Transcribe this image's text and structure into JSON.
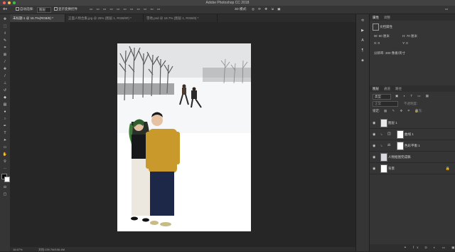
{
  "window": {
    "title": "Adobe Photoshop CC 2018",
    "traffic_lights": [
      "#fc605b",
      "#fdbc40",
      "#34c84a"
    ]
  },
  "options_bar": {
    "auto_select_label": "自动选择:",
    "auto_select_value": "图层",
    "show_transform_label": "显示变换控件",
    "mode_3d_label": "3D 模式:"
  },
  "tabs": [
    {
      "label": "未标题-1 @ 16.7%(RGB/8) *",
      "active": true
    },
    {
      "label": "正面人物合集.jpg @ 25% (图层 1, RGB/8#) *",
      "active": false
    },
    {
      "label": "雪地.psd @ 18.7% (图层 1, RGB/8) *",
      "active": false
    }
  ],
  "status": {
    "zoom": "16.67%",
    "doc_size": "文档:139.7M/106.4M"
  },
  "properties_panel": {
    "tabs": [
      "属性",
      "调整"
    ],
    "section_title": "文档属性",
    "width_label": "W: 60 厘米",
    "height_label": "H: 70 厘米",
    "x_label": "X: 0",
    "y_label": "Y: 0",
    "resolution": "分辨率: 300 像素/英寸"
  },
  "layers_panel": {
    "tabs": [
      "图层",
      "通道",
      "路径"
    ],
    "filter_kind": "类型",
    "blend_mode": "正常",
    "opacity_label": "不透明度:",
    "lock_label": "锁定:",
    "fill_label": "填充:",
    "layers": [
      {
        "name": "图层 1",
        "type": "image"
      },
      {
        "name": "曲线 1",
        "type": "curves"
      },
      {
        "name": "色彩平衡 1",
        "type": "balance"
      },
      {
        "name": "人物抠图完成稿",
        "type": "image"
      },
      {
        "name": "背景",
        "type": "background",
        "locked": true
      }
    ]
  },
  "icons": {
    "toolbox": [
      "move-icon",
      "marquee-icon",
      "lasso-icon",
      "quick-select-icon",
      "crop-icon",
      "eyedropper-icon",
      "healing-icon",
      "brush-icon",
      "stamp-icon",
      "history-brush-icon",
      "eraser-icon",
      "gradient-icon",
      "blur-icon",
      "dodge-icon",
      "pen-icon",
      "type-icon",
      "path-select-icon",
      "shape-icon",
      "hand-icon",
      "zoom-icon",
      "more-icon"
    ]
  }
}
